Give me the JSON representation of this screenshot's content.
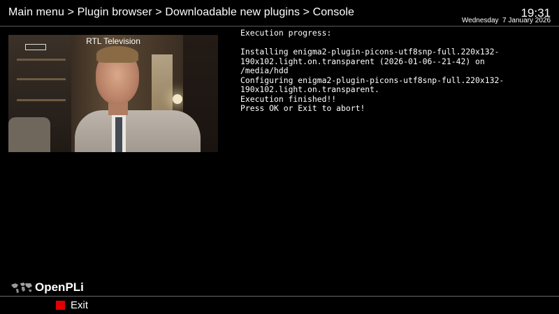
{
  "header": {
    "breadcrumb": "Main menu > Plugin browser > Downloadable new plugins > Console",
    "time": "19:31",
    "date": "Wednesday  7 January 2026"
  },
  "preview": {
    "channel_name": "RTL Television"
  },
  "console": {
    "lines": [
      "Execution progress:",
      "",
      "Installing enigma2-plugin-picons-utf8snp-full.220x132-",
      "190x102.light.on.transparent (2026-01-06--21-42) on",
      "/media/hdd",
      "Configuring enigma2-plugin-picons-utf8snp-full.220x132-",
      "190x102.light.on.transparent.",
      "Execution finished!!",
      "Press OK or Exit to abort!"
    ]
  },
  "footer": {
    "brand": "OpenPLi",
    "exit_label": "Exit",
    "red_key_color": "#e10000"
  }
}
